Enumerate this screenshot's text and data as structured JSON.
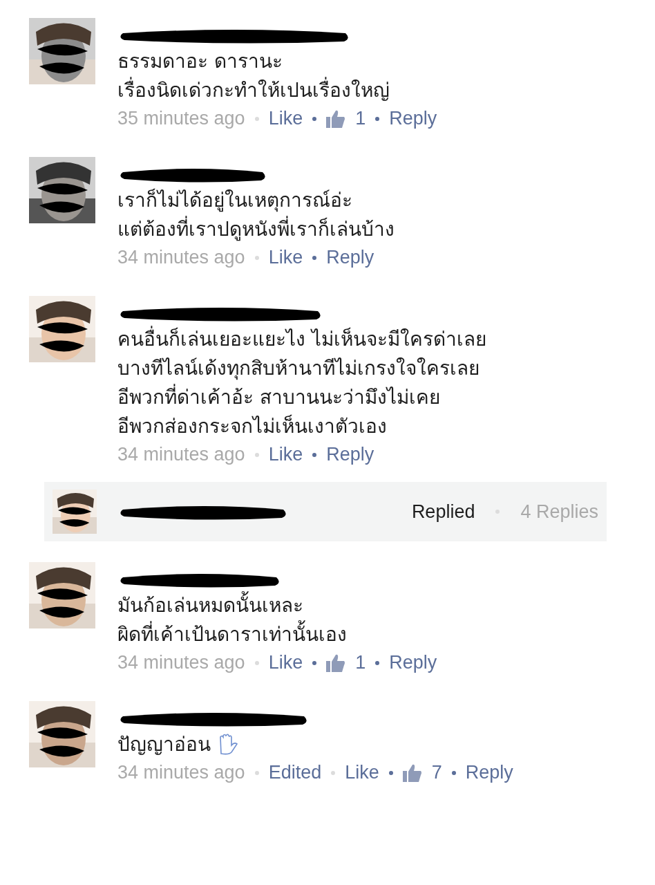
{
  "comments": [
    {
      "kind": "comment",
      "lines": [
        "ธรรมดาอะ ดารานะ",
        "เรื่องนิดเด่วกะทำให้เปนเรื่องใหญ่"
      ],
      "time": "35 minutes ago",
      "like": "Like",
      "likes": "1",
      "reply": "Reply"
    },
    {
      "kind": "comment",
      "lines": [
        "เราก็ไม่ได้อยู่ในเหตุการณ์อ่ะ",
        "แต่ต้องที่เราปดูหนังพี่เราก็เล่นบ้าง"
      ],
      "time": "34 minutes ago",
      "like": "Like",
      "reply": "Reply"
    },
    {
      "kind": "comment",
      "lines": [
        "คนอื่นก็เล่นเยอะแยะไง ไม่เห็นจะมีใครด่าเลย",
        "บางทีไลน์เด้งทุกสิบห้านาทีไม่เกรงใจใครเลย",
        "อีพวกที่ด่าเค้าอ้ะ สาบานนะว่ามึงไม่เคย",
        "อีพวกส่องกระจกไม่เห็นเงาตัวเอง"
      ],
      "time": "34 minutes ago",
      "like": "Like",
      "reply": "Reply"
    },
    {
      "kind": "reply_summary",
      "status": "Replied",
      "count": "4 Replies"
    },
    {
      "kind": "comment",
      "lines": [
        "มันก้อเล่นหมดนั้นเหละ",
        "ผิดที่เค้าเป้นดาราเท่านั้นเอง"
      ],
      "time": "34 minutes ago",
      "like": "Like",
      "likes": "1",
      "reply": "Reply"
    },
    {
      "kind": "comment",
      "lines": [
        "ปัญญาอ่อน"
      ],
      "hand": true,
      "time": "34 minutes ago",
      "edited_label": "Edited",
      "like": "Like",
      "likes": "7",
      "reply": "Reply"
    }
  ]
}
